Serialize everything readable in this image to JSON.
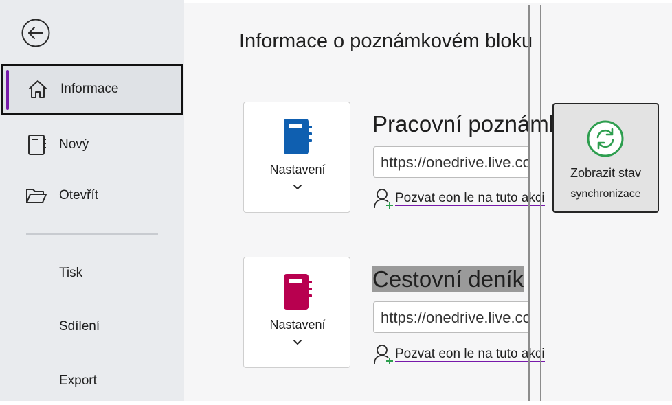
{
  "sidebar": {
    "back_label": "Zpět",
    "items": [
      {
        "label": "Informace",
        "icon": "home-icon",
        "selected": true
      },
      {
        "label": "Nový",
        "icon": "new-notebook-icon"
      },
      {
        "label": "Otevřít",
        "icon": "folder-open-icon"
      },
      {
        "label": "Tisk"
      },
      {
        "label": "Sdílení"
      },
      {
        "label": "Export"
      }
    ]
  },
  "main": {
    "title": "Informace o poznámkovém bloku",
    "notebooks": [
      {
        "name": "Pracovní poznámka",
        "settings_label": "Nastavení",
        "url": "https://onedrive.live.com",
        "invite_label": "Pozvat eon le na tuto akci",
        "icon_color": "#0f5fb0"
      },
      {
        "name": "Cestovní deník",
        "settings_label": "Nastavení",
        "url": "https://onedrive.live.com",
        "invite_label": "Pozvat eon le na tuto akci",
        "icon_color": "#b8004f"
      }
    ],
    "sync": {
      "line1": "Zobrazit stav",
      "line2": "synchronizace",
      "icon_color": "#2e9e4f"
    }
  },
  "colors": {
    "accent": "#7719aa",
    "sidebar_bg": "#e9ebee",
    "main_bg": "#f6f6f7"
  }
}
